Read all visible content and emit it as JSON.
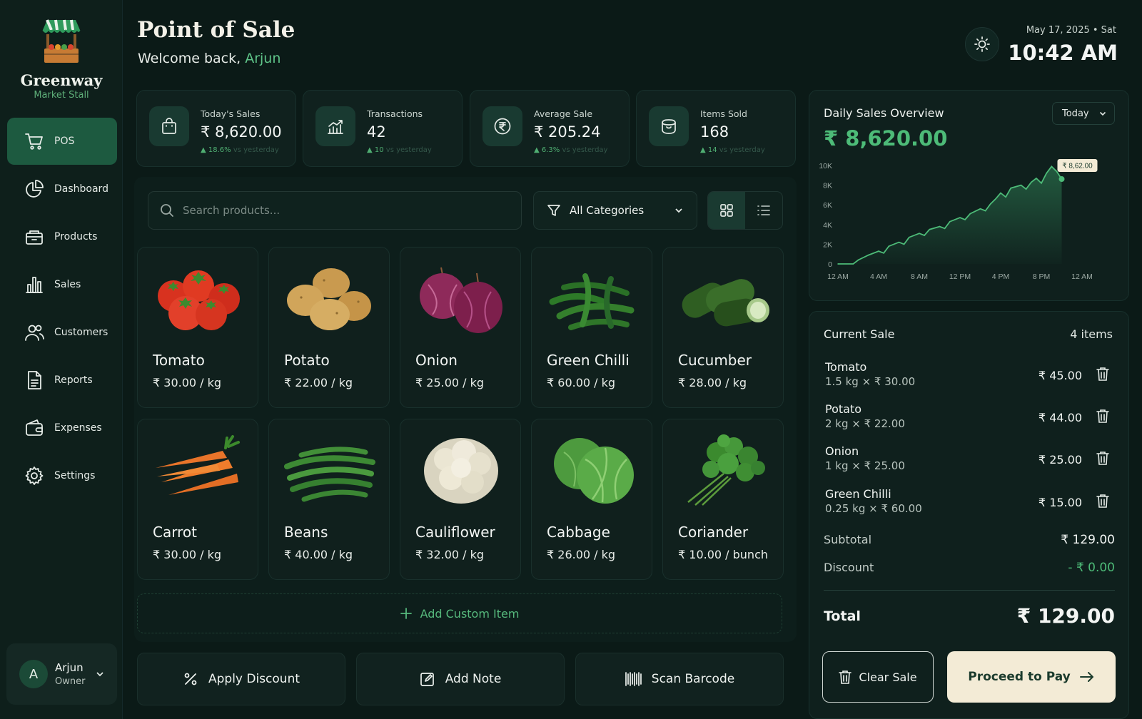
{
  "brand": {
    "name": "Greenway",
    "subtitle": "Market Stall"
  },
  "nav": [
    {
      "label": "POS",
      "icon": "cart-icon",
      "active": true
    },
    {
      "label": "Dashboard",
      "icon": "pie-chart-icon"
    },
    {
      "label": "Products",
      "icon": "basket-icon"
    },
    {
      "label": "Sales",
      "icon": "bar-chart-icon"
    },
    {
      "label": "Customers",
      "icon": "users-icon"
    },
    {
      "label": "Reports",
      "icon": "report-icon"
    },
    {
      "label": "Expenses",
      "icon": "wallet-icon"
    },
    {
      "label": "Settings",
      "icon": "gear-icon"
    }
  ],
  "user": {
    "initial": "A",
    "name": "Arjun",
    "role": "Owner"
  },
  "header": {
    "title": "Point of Sale",
    "welcome_prefix": "Welcome back,",
    "welcome_name": "Arjun",
    "date": "May 17, 2025  •  Sat",
    "time": "10:42 AM"
  },
  "stats": [
    {
      "label": "Today's Sales",
      "value": "₹ 8,620.00",
      "delta": "▲ 18.6%",
      "delta_note": "vs yesterday",
      "icon": "shopping-bag-icon"
    },
    {
      "label": "Transactions",
      "value": "42",
      "delta": "▲ 10",
      "delta_note": "vs yesterday",
      "icon": "trend-chart-icon"
    },
    {
      "label": "Average Sale",
      "value": "₹ 205.24",
      "delta": "▲ 6.3%",
      "delta_note": "vs yesterday",
      "icon": "rupee-coin-icon"
    },
    {
      "label": "Items Sold",
      "value": "168",
      "delta": "▲ 14",
      "delta_note": "vs yesterday",
      "icon": "box-icon"
    }
  ],
  "search": {
    "placeholder": "Search products..."
  },
  "category_filter": {
    "selected": "All Categories"
  },
  "products": [
    {
      "name": "Tomato",
      "price": "₹ 30.00 / kg"
    },
    {
      "name": "Potato",
      "price": "₹ 22.00 / kg"
    },
    {
      "name": "Onion",
      "price": "₹ 25.00 / kg"
    },
    {
      "name": "Green Chilli",
      "price": "₹ 60.00 / kg"
    },
    {
      "name": "Cucumber",
      "price": "₹ 28.00 / kg"
    },
    {
      "name": "Carrot",
      "price": "₹ 30.00 / kg"
    },
    {
      "name": "Beans",
      "price": "₹ 40.00 / kg"
    },
    {
      "name": "Cauliflower",
      "price": "₹ 32.00 / kg"
    },
    {
      "name": "Cabbage",
      "price": "₹ 26.00 / kg"
    },
    {
      "name": "Coriander",
      "price": "₹ 10.00 / bunch"
    }
  ],
  "add_custom_label": "Add Custom Item",
  "actions": {
    "discount": "Apply Discount",
    "note": "Add Note",
    "scan": "Scan Barcode"
  },
  "overview": {
    "title": "Daily Sales Overview",
    "total": "₹ 8,620.00",
    "range": "Today",
    "peak_label": "₹ 8,62.00"
  },
  "chart_data": {
    "type": "area",
    "x": [
      "12 AM",
      "4 AM",
      "8 AM",
      "12 PM",
      "4 PM",
      "8 PM",
      "12 AM"
    ],
    "y_ticks": [
      "0",
      "2K",
      "4K",
      "6K",
      "8K",
      "10K"
    ],
    "ylim": [
      0,
      10000
    ],
    "series": [
      {
        "hours": [
          0,
          1.5,
          2,
          3,
          4,
          4.5,
          5,
          6,
          6.5,
          7,
          8,
          8.5,
          9,
          10,
          10.5,
          11,
          12,
          12.5,
          13,
          14,
          14.5,
          15,
          15.5,
          16,
          16.5,
          17,
          18,
          18.5,
          19,
          19.5,
          20,
          20.5,
          21,
          21.5,
          22
        ],
        "values": [
          0,
          0,
          400,
          900,
          1300,
          1100,
          1800,
          2200,
          2000,
          2700,
          3100,
          2900,
          3500,
          3800,
          3600,
          4300,
          4700,
          4500,
          5100,
          5600,
          5400,
          6100,
          6600,
          7200,
          6800,
          7700,
          8000,
          7600,
          8300,
          8700,
          8200,
          9200,
          9900,
          9400,
          8620
        ]
      }
    ]
  },
  "cart": {
    "title": "Current Sale",
    "count": "4 items",
    "items": [
      {
        "name": "Tomato",
        "detail": "1.5 kg × ₹ 30.00",
        "total": "₹ 45.00"
      },
      {
        "name": "Potato",
        "detail": "2 kg × ₹ 22.00",
        "total": "₹ 44.00"
      },
      {
        "name": "Onion",
        "detail": "1 kg × ₹ 25.00",
        "total": "₹ 25.00"
      },
      {
        "name": "Green Chilli",
        "detail": "0.25 kg × ₹ 60.00",
        "total": "₹ 15.00"
      }
    ],
    "subtotal_label": "Subtotal",
    "subtotal": "₹ 129.00",
    "discount_label": "Discount",
    "discount": "- ₹ 0.00",
    "total_label": "Total",
    "total": "₹ 129.00",
    "clear_label": "Clear Sale",
    "pay_label": "Proceed to Pay"
  }
}
